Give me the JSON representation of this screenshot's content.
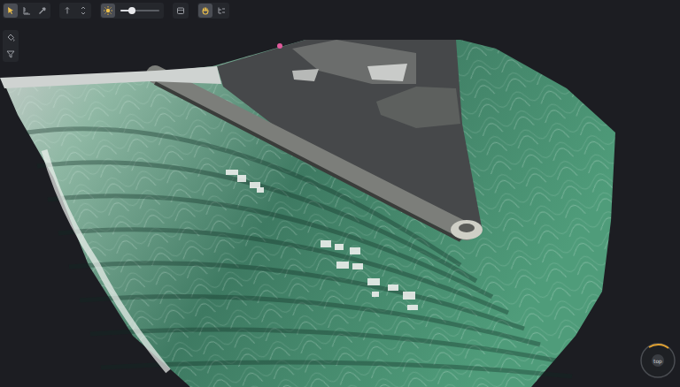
{
  "toolbar": {
    "groups": [
      {
        "items": [
          {
            "kind": "button",
            "selected": true
          },
          {
            "kind": "button",
            "selected": false
          },
          {
            "kind": "button",
            "selected": false
          }
        ]
      },
      {
        "items": [
          {
            "kind": "button",
            "selected": false
          },
          {
            "kind": "button",
            "selected": false
          }
        ]
      },
      {
        "items": [
          {
            "kind": "button",
            "selected": true
          },
          {
            "kind": "slider",
            "level": 0.3
          }
        ]
      },
      {
        "items": [
          {
            "kind": "button",
            "selected": false
          }
        ]
      },
      {
        "items": [
          {
            "kind": "button",
            "selected": true
          },
          {
            "kind": "button",
            "selected": false
          }
        ]
      }
    ]
  },
  "side_tools": [
    {
      "selected": false
    },
    {
      "selected": false
    }
  ],
  "compass": {
    "label": "top"
  }
}
